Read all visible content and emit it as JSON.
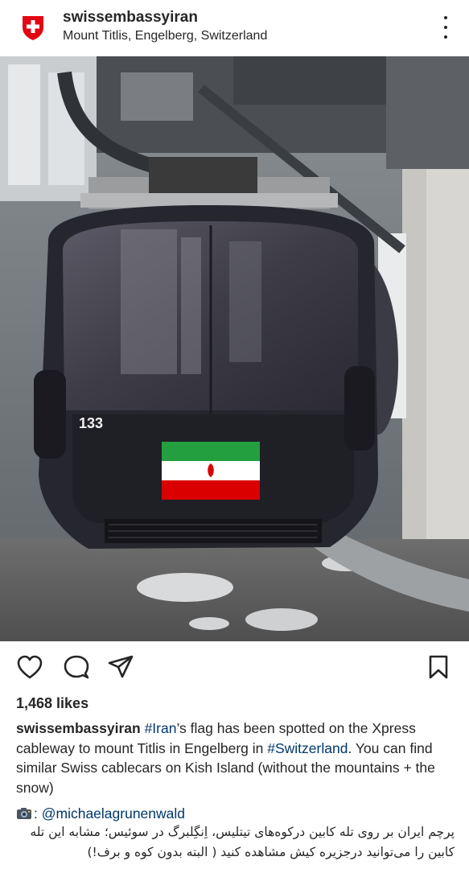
{
  "post": {
    "username": "swissembassyiran",
    "location": "Mount Titlis, Engelberg, Switzerland",
    "likes": "1,468 likes",
    "caption": {
      "username": "swissembassyiran",
      "hashtag_iran": "#Iran",
      "text_1": "’s flag has been spotted on the Xpress cableway to mount Titlis in Engelberg in ",
      "hashtag_switzerland": "#Switzerland",
      "text_2": ". You can find similar Swiss cablecars on Kish Island (without the mountains + the snow)",
      "credit_prefix": ": ",
      "credit_mention": "@michaelagrunenwald",
      "persian_text": "پرچم ایران بر روی تله کابین درکوه‌های تیتلیس، اِنگِلبرگ در سوئیس؛ مشابه این تله کابین را می‌توانید درجزیره کیش مشاهده کنید ( البته بدون کوه و برف!)"
    }
  },
  "photo": {
    "cabin_number": "133"
  },
  "icons": {
    "avatar": "swiss-cross-icon",
    "more": "more-options-icon",
    "like": "heart-icon",
    "comment": "comment-bubble-icon",
    "share": "paper-plane-icon",
    "save": "bookmark-icon",
    "credit": "camera-icon"
  },
  "colors": {
    "text": "#262626",
    "link": "#00376b",
    "swiss_red": "#e30613",
    "flag_green": "#239f40",
    "flag_red": "#da0000"
  }
}
